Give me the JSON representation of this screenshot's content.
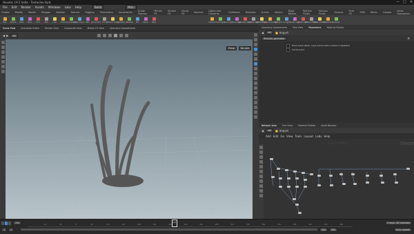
{
  "window": {
    "title": "Houdini 19.5 Indie - Tentacles.hiplc",
    "controls": [
      "—",
      "□",
      "✕"
    ]
  },
  "menu": {
    "items": [
      "File",
      "Edit",
      "Render",
      "Assets",
      "Windows",
      "Labs",
      "Help"
    ],
    "build_label": "Build",
    "desktop_label": "Main"
  },
  "shelf_tabs": {
    "left": [
      "Create",
      "Modify",
      "Model",
      "Polygon",
      "Deform",
      "Texture",
      "Rigging",
      "Characters",
      "Constraints",
      "Guide Process",
      "Terrain FX",
      "Simple FX",
      "Cloud FX",
      "Volume"
    ],
    "right": [
      "Lights and Cameras",
      "Collisions",
      "Particles",
      "Grains",
      "Vellum",
      "Rigid Bodies",
      "Particle Fluids",
      "Viscous Fluids",
      "Oceans",
      "Pyro FX",
      "FEM",
      "Wires",
      "Crowds",
      "Drive Simulation"
    ]
  },
  "shelf_tools": {
    "left": [
      "Box",
      "Sphere",
      "Tube",
      "Torus",
      "Grid",
      "Null",
      "Line",
      "Circle",
      "Curve Bezier",
      "Draw Curve",
      "Path",
      "Spray Paint",
      "Font",
      "Platonic Solids",
      "L-System",
      "Metaball",
      "File",
      "Spiral",
      "Helix"
    ],
    "right": [
      "Camera",
      "Point Light",
      "Spot Light",
      "Area Light",
      "Geometry Light",
      "Volume Light",
      "Distant Light",
      "Environment Light",
      "Sky Light",
      "GI Light",
      "Caustic Light",
      "Portal Light",
      "Ambient Light",
      "Stereo Camera",
      "VR Camera",
      "Switcher"
    ]
  },
  "viewport": {
    "tabs": [
      "Scene View",
      "Animation Editor",
      "Render View",
      "Composite View",
      "Motion FX View",
      "Geometry Spreadsheet"
    ],
    "path": "obj",
    "camera_buttons": [
      "Persp",
      "No cam"
    ]
  },
  "right_top": {
    "tabs": [
      "Geometry Spreadsheet",
      "Tree View",
      "Parameters",
      "Material Palette"
    ],
    "path": "obj",
    "node": "Import",
    "node_type_label": "Tentacle_generator",
    "param_rows": [
      "Extra Input (Note: input will be USD-content if disabled)",
      "Cache Input"
    ]
  },
  "right_bottom": {
    "tabs": [
      "Network View",
      "Tree View",
      "Material Palette",
      "Asset Browser"
    ],
    "path": "obj",
    "node": "Import",
    "menu": [
      "Add",
      "Edit",
      "Go",
      "View",
      "Tools",
      "Layout",
      "Labs",
      "Help"
    ],
    "watermark": "Geometry",
    "watermark2": "Geom"
  },
  "timeline": {
    "current_frame": "224",
    "start": "1",
    "end": "500",
    "range_end": "500",
    "frame_marks": [
      "24",
      "48",
      "72",
      "96",
      "120",
      "144",
      "168",
      "192",
      "216",
      "240",
      "264",
      "288",
      "312",
      "336",
      "360",
      "384",
      "408",
      "432",
      "456",
      "480"
    ],
    "cursor_frame": "224",
    "keys_label": "0 keys, 0/0 channels",
    "key_all": "Key All Channels",
    "auto_update": "Auto Update"
  },
  "colors": {
    "accent": "#f2c94c",
    "viewport_top": "#5f6f7a",
    "viewport_bottom": "#b9c5cb",
    "node_wire": "#7a9bc7"
  }
}
